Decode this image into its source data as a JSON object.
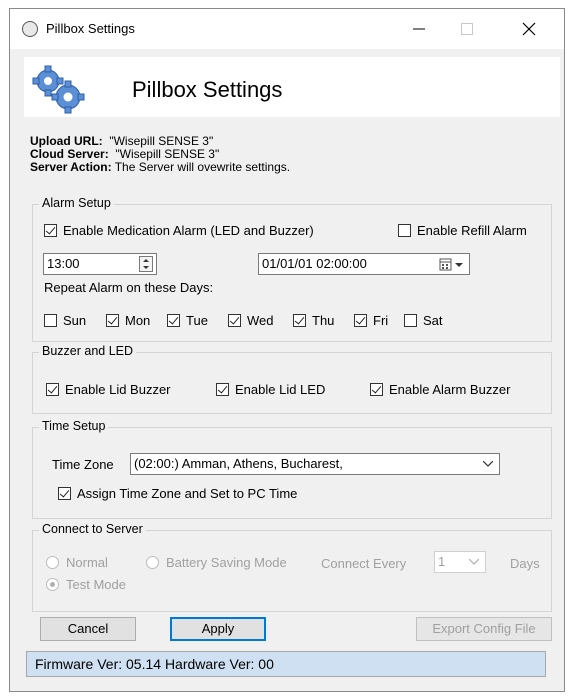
{
  "window": {
    "title": "Pillbox Settings"
  },
  "banner": {
    "title": "Pillbox Settings",
    "icon": "gears-icon"
  },
  "info": {
    "upload_label": "Upload URL:",
    "upload_value": "\"Wisepill SENSE 3\"",
    "cloud_label": "Cloud Server:",
    "cloud_value": "\"Wisepill SENSE 3\"",
    "action_label": "Server Action:",
    "action_value": "The Server will ovewrite settings."
  },
  "alarm": {
    "group_label": "Alarm Setup",
    "enable_med": {
      "label": "Enable Medication Alarm (LED and Buzzer)",
      "checked": true
    },
    "enable_refill": {
      "label": "Enable Refill Alarm",
      "checked": false
    },
    "time": "13:00",
    "datetime": "01/01/01 02:00:00",
    "repeat_label": "Repeat Alarm on these Days:",
    "days": [
      {
        "label": "Sun",
        "checked": false
      },
      {
        "label": "Mon",
        "checked": true
      },
      {
        "label": "Tue",
        "checked": true
      },
      {
        "label": "Wed",
        "checked": true
      },
      {
        "label": "Thu",
        "checked": true
      },
      {
        "label": "Fri",
        "checked": true
      },
      {
        "label": "Sat",
        "checked": false
      }
    ]
  },
  "buzzer": {
    "group_label": "Buzzer and LED",
    "lid_buzzer": {
      "label": "Enable Lid Buzzer",
      "checked": true
    },
    "lid_led": {
      "label": "Enable Lid LED",
      "checked": true
    },
    "alarm_buzzer": {
      "label": "Enable Alarm Buzzer",
      "checked": true
    }
  },
  "time_setup": {
    "group_label": "Time Setup",
    "zone_label": "Time Zone",
    "zone_value": "(02:00:)  Amman,  Athens,  Bucharest,",
    "assign": {
      "label": "Assign Time Zone and Set to PC Time",
      "checked": true
    }
  },
  "server": {
    "group_label": "Connect to Server",
    "normal": "Normal",
    "battery": "Battery Saving Mode",
    "connect_every": "Connect Every",
    "every_value": "1",
    "days": "Days",
    "test_mode": "Test Mode"
  },
  "buttons": {
    "cancel": "Cancel",
    "apply": "Apply",
    "export": "Export Config File"
  },
  "status": {
    "text": "Firmware Ver: 05.14 Hardware Ver: 00"
  }
}
